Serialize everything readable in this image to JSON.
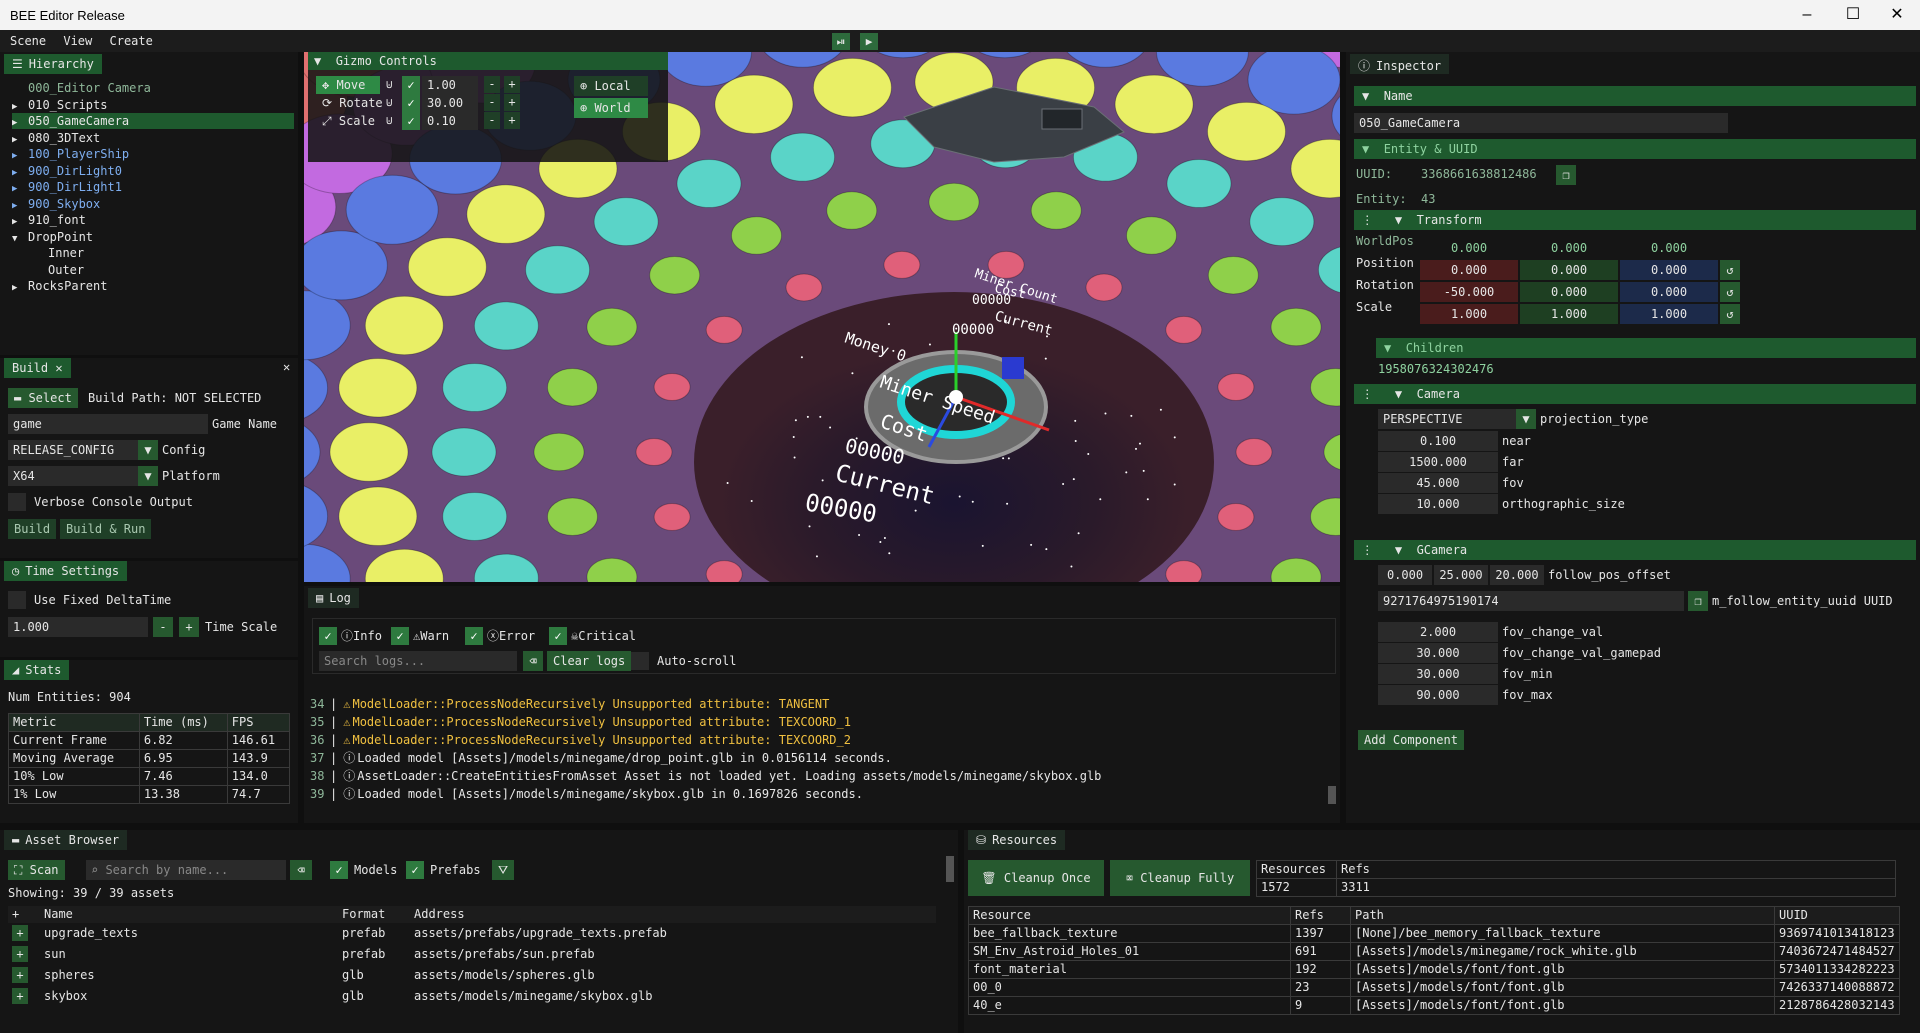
{
  "window": {
    "title": "BEE Editor Release",
    "min": "–",
    "max": "☐",
    "close": "✕"
  },
  "menu": [
    "Scene",
    "View",
    "Create"
  ],
  "play": {
    "step": "⏯",
    "play": "▶"
  },
  "hierarchy": {
    "title": "Hierarchy",
    "items": [
      {
        "label": "000_Editor Camera",
        "arrow": "",
        "color": "muted",
        "indent": 0
      },
      {
        "label": "010_Scripts",
        "arrow": "▶",
        "color": "",
        "indent": 0
      },
      {
        "label": "050_GameCamera",
        "arrow": "▶",
        "color": "",
        "indent": 0
      },
      {
        "label": "080_3DText",
        "arrow": "▶",
        "color": "",
        "indent": 0
      },
      {
        "label": "100_PlayerShip",
        "arrow": "▶",
        "color": "blue",
        "indent": 0
      },
      {
        "label": "900_DirLight0",
        "arrow": "▶",
        "color": "blue",
        "indent": 0
      },
      {
        "label": "900_DirLight1",
        "arrow": "▶",
        "color": "blue",
        "indent": 0
      },
      {
        "label": "900_Skybox",
        "arrow": "▶",
        "color": "blue",
        "indent": 0
      },
      {
        "label": "910_font",
        "arrow": "▶",
        "color": "",
        "indent": 0
      },
      {
        "label": "DropPoint",
        "arrow": "▼",
        "color": "",
        "indent": 0
      },
      {
        "label": "Inner",
        "arrow": "",
        "color": "",
        "indent": 1
      },
      {
        "label": "Outer",
        "arrow": "",
        "color": "",
        "indent": 1
      },
      {
        "label": "RocksParent",
        "arrow": "▶",
        "color": "",
        "indent": 0
      }
    ]
  },
  "build": {
    "title": "Build",
    "close": "✕",
    "select": "Select",
    "path": "Build Path: NOT SELECTED",
    "game": "game",
    "game_label": "Game Name",
    "config": "RELEASE_CONFIG",
    "config_label": "Config",
    "platform": "X64",
    "platform_label": "Platform",
    "verbose": "Verbose Console Output",
    "build_btn": "Build",
    "build_run": "Build & Run"
  },
  "time": {
    "title": "Time Settings",
    "fixed": "Use Fixed DeltaTime",
    "scale": "1.000",
    "minus": "-",
    "plus": "+",
    "scale_label": "Time Scale"
  },
  "stats": {
    "title": "Stats",
    "entities": "Num Entities: 904",
    "headers": [
      "Metric",
      "Time (ms)",
      "FPS"
    ],
    "rows": [
      [
        "Current Frame",
        "6.82",
        "146.61"
      ],
      [
        "Moving Average",
        "6.95",
        "143.9"
      ],
      [
        "10% Low",
        "7.46",
        "134.0"
      ],
      [
        "1% Low",
        "13.38",
        "74.7"
      ]
    ]
  },
  "gizmo": {
    "title": "Gizmo Controls",
    "modes": [
      {
        "label": "Move",
        "icon": "✥",
        "value": "1.00"
      },
      {
        "label": "Rotate",
        "icon": "⟳",
        "value": "30.00"
      },
      {
        "label": "Scale",
        "icon": "⤢",
        "value": "0.10"
      }
    ],
    "local": "Local",
    "world": "World",
    "minus": "-",
    "plus": "+"
  },
  "scene_text": {
    "miner_count": "Miner Count",
    "cost1": "Cost",
    "c1": "00000",
    "current1": "Current",
    "c2": "00000",
    "money": "Money 0",
    "miner_speed": "Miner Speed",
    "cost2": "Cost",
    "c3": "00000",
    "current2": "Current",
    "c4": "00000"
  },
  "log": {
    "title": "Log",
    "info": "Info",
    "warn": "Warn",
    "error": "Error",
    "critical": "Critical",
    "search": "Search logs...",
    "clear": "Clear logs",
    "autoscroll": "Auto-scroll",
    "lines": [
      {
        "n": "34",
        "type": "warn",
        "text": "ModelLoader::ProcessNodeRecursively Unsupported attribute: TANGENT"
      },
      {
        "n": "35",
        "type": "warn",
        "text": "ModelLoader::ProcessNodeRecursively Unsupported attribute: TEXCOORD_1"
      },
      {
        "n": "36",
        "type": "warn",
        "text": "ModelLoader::ProcessNodeRecursively Unsupported attribute: TEXCOORD_2"
      },
      {
        "n": "37",
        "type": "info",
        "text": "Loaded model [Assets]/models/minegame/drop_point.glb in 0.0156114 seconds."
      },
      {
        "n": "38",
        "type": "info",
        "text": "AssetLoader::CreateEntitiesFromAsset Asset is not loaded yet. Loading assets/models/minegame/skybox.glb"
      },
      {
        "n": "39",
        "type": "info",
        "text": "Loaded model [Assets]/models/minegame/skybox.glb in 0.1697826 seconds."
      }
    ]
  },
  "inspector": {
    "title": "Inspector",
    "name_label": "Name",
    "name": "050_GameCamera",
    "entity_uuid": "Entity & UUID",
    "uuid_label": "UUID:",
    "uuid": "3368661638812486",
    "entity_label": "Entity:",
    "entity": "43",
    "transform": "Transform",
    "worldpos": "WorldPos",
    "worldpos_v": [
      "0.000",
      "0.000",
      "0.000"
    ],
    "position": "Position",
    "position_v": [
      "0.000",
      "0.000",
      "0.000"
    ],
    "rotation": "Rotation",
    "rotation_v": [
      "-50.000",
      "0.000",
      "0.000"
    ],
    "scale": "Scale",
    "scale_v": [
      "1.000",
      "1.000",
      "1.000"
    ],
    "children": "Children",
    "child_id": "1958076324302476",
    "camera": "Camera",
    "proj": "PERSPECTIVE",
    "proj_label": "projection_type",
    "cam_fields": [
      {
        "v": "0.100",
        "l": "near"
      },
      {
        "v": "1500.000",
        "l": "far"
      },
      {
        "v": "45.000",
        "l": "fov"
      },
      {
        "v": "10.000",
        "l": "orthographic_size"
      }
    ],
    "gcamera": "GCamera",
    "offset": [
      "0.000",
      "25.000",
      "20.000"
    ],
    "offset_label": "follow_pos_offset",
    "follow_uuid": "9271764975190174",
    "follow_label": "m_follow_entity_uuid UUID",
    "gcam_fields": [
      {
        "v": "2.000",
        "l": "fov_change_val"
      },
      {
        "v": "30.000",
        "l": "fov_change_val_gamepad"
      },
      {
        "v": "30.000",
        "l": "fov_min"
      },
      {
        "v": "90.000",
        "l": "fov_max"
      }
    ],
    "add": "Add Component"
  },
  "assets": {
    "title": "Asset Browser",
    "scan": "Scan",
    "search": "Search by name...",
    "models": "Models",
    "prefabs": "Prefabs",
    "showing": "Showing: 39 / 39 assets",
    "headers": [
      "+",
      "Name",
      "Format",
      "Address"
    ],
    "rows": [
      [
        "upgrade_texts",
        "prefab",
        "assets/prefabs/upgrade_texts.prefab"
      ],
      [
        "sun",
        "prefab",
        "assets/prefabs/sun.prefab"
      ],
      [
        "spheres",
        "glb",
        "assets/models/spheres.glb"
      ],
      [
        "skybox",
        "glb",
        "assets/models/minegame/skybox.glb"
      ]
    ]
  },
  "resources": {
    "title": "Resources",
    "cleanup_once": "Cleanup Once",
    "cleanup_fully": "Cleanup Fully",
    "sum_headers": [
      "Resources",
      "Refs"
    ],
    "sum_values": [
      "1572",
      "3311"
    ],
    "headers": [
      "Resource",
      "Refs",
      "Path",
      "UUID"
    ],
    "rows": [
      [
        "bee_fallback_texture",
        "1397",
        "[None]/bee_memory_fallback_texture",
        "9369741013418123"
      ],
      [
        "SM_Env_Astroid_Holes_01",
        "691",
        "[Assets]/models/minegame/rock_white.glb",
        "7403672471484527"
      ],
      [
        "font_material",
        "192",
        "[Assets]/models/font/font.glb",
        "5734011334282223"
      ],
      [
        "00_0",
        "23",
        "[Assets]/models/font/font.glb",
        "7426337140088872"
      ],
      [
        "40_e",
        "9",
        "[Assets]/models/font/font.glb",
        "2128786428032143"
      ]
    ]
  }
}
